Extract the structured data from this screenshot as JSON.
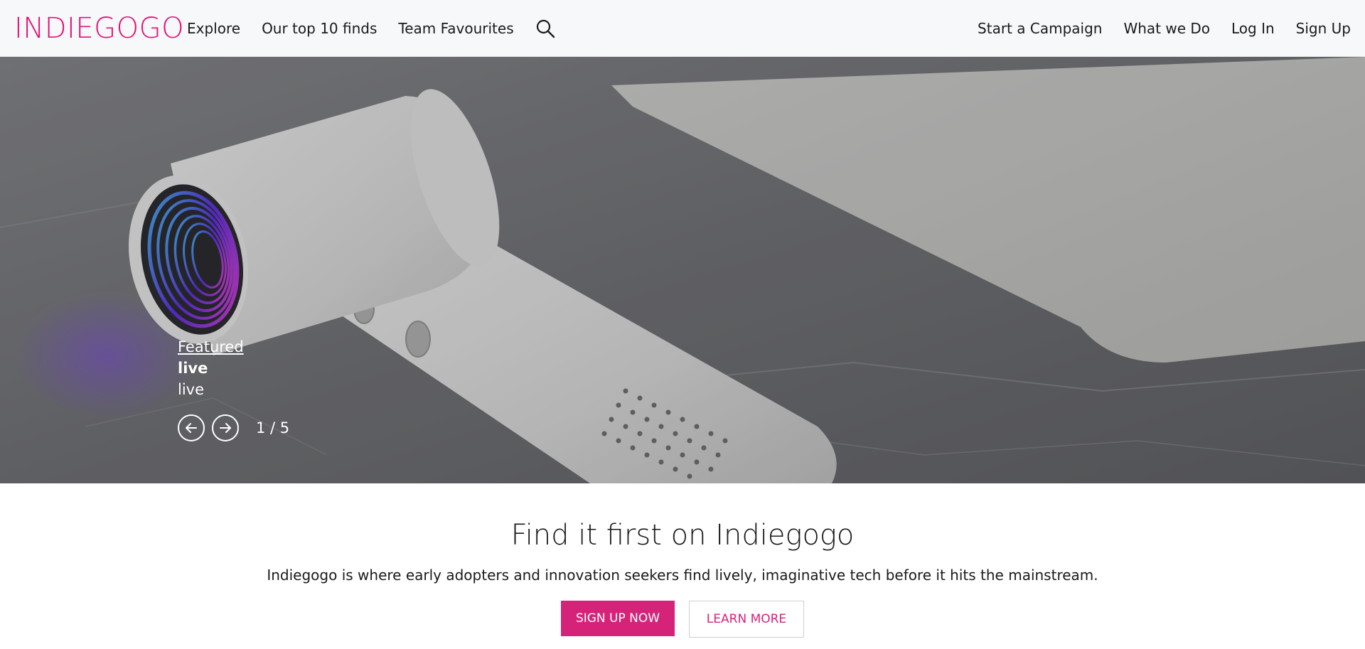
{
  "colors": {
    "brand": "#e51075",
    "primary_button": "#d6237a",
    "header_bg": "#f7f8fa"
  },
  "header": {
    "logo": "INDIEGOGO",
    "nav_left": [
      "Explore",
      "Our top 10 finds",
      "Team Favourites"
    ],
    "search_icon": "search-icon",
    "nav_right": [
      "Start a Campaign",
      "What we Do",
      "Log In",
      "Sign Up"
    ]
  },
  "hero": {
    "featured_label": "Featured",
    "title": "live",
    "subtitle": "live",
    "prev_icon": "arrow-left-icon",
    "next_icon": "arrow-right-icon",
    "counter": "1 / 5"
  },
  "content": {
    "headline": "Find it first on Indiegogo",
    "description": "Indiegogo is where early adopters and innovation seekers find lively, imaginative tech before it hits the mainstream.",
    "primary_button": "SIGN UP NOW",
    "secondary_button": "LEARN MORE"
  }
}
